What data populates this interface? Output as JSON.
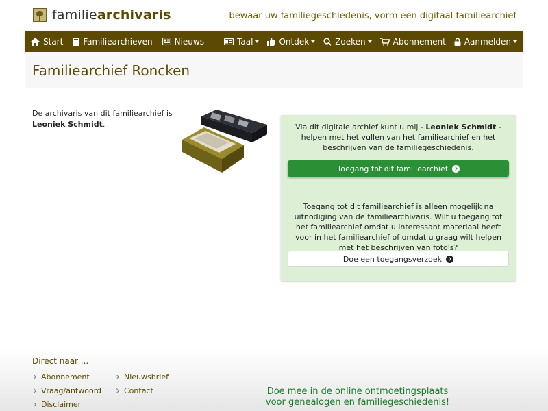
{
  "logo": {
    "text_light": "familie",
    "text_bold": "archivaris"
  },
  "tagline": "bewaar uw familiegeschiedenis, vorm een digitaal familiearchief",
  "nav": {
    "left": [
      {
        "label": "Start",
        "icon": "home-icon"
      },
      {
        "label": "Familiearchieven",
        "icon": "book-icon"
      },
      {
        "label": "Nieuws",
        "icon": "newspaper-icon"
      }
    ],
    "right": [
      {
        "label": "Taal",
        "icon": "language-icon",
        "dropdown": true
      },
      {
        "label": "Ontdek",
        "icon": "thumbs-up-icon",
        "dropdown": true
      },
      {
        "label": "Zoeken",
        "icon": "search-icon",
        "dropdown": true
      },
      {
        "label": "Abonnement",
        "icon": "cart-icon",
        "dropdown": false
      },
      {
        "label": "Aanmelden",
        "icon": "lock-icon",
        "dropdown": true
      }
    ]
  },
  "page_title": "Familiearchief Roncken",
  "intro": {
    "prefix": "De archivaris van dit familiearchief is ",
    "name": "Leoniek Schmidt",
    "suffix": "."
  },
  "panel": {
    "text1_prefix": "Via dit digitale archief kunt u mij - ",
    "text1_name": "Leoniek Schmidt",
    "text1_suffix": " - helpen met het vullen van het familiearchief en het beschrijven van de familiegeschiedenis.",
    "access_button": "Toegang tot dit familiearchief",
    "text2": "Toegang tot dit familiearchief is alleen mogelijk na uitnodiging van de familiearchivaris. Wilt u toegang tot het familiearchief omdat u interessant materiaal heeft voor in het familiearchief of omdat u graag wilt helpen met het beschrijven van foto's?",
    "request_button": "Doe een toegangsverzoek"
  },
  "footer": {
    "heading": "Direct naar ...",
    "links_col1": [
      "Abonnement",
      "Vraag/antwoord",
      "Disclaimer"
    ],
    "links_col2": [
      "Nieuwsbrief",
      "Contact"
    ],
    "slogan_line1": "Doe mee in de online ontmoetingsplaats",
    "slogan_line2": "voor genealogen en familiegeschiedenis!"
  },
  "colors": {
    "brand": "#5c4a02",
    "accent_green": "#2a8f35",
    "panel_bg": "#ddf0d6"
  }
}
